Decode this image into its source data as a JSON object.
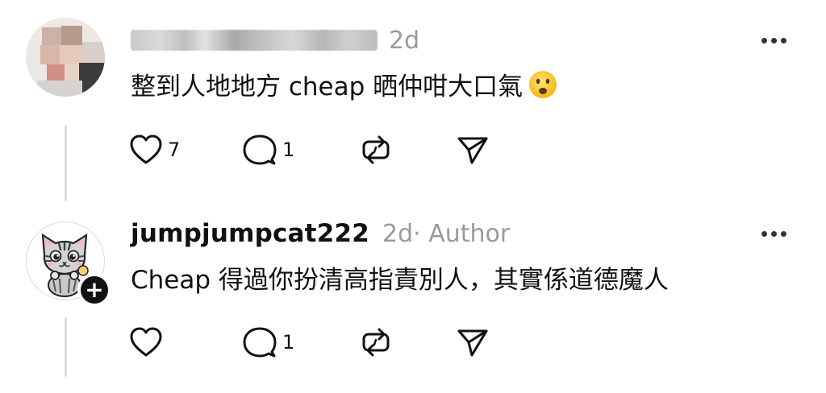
{
  "comments": [
    {
      "username": "",
      "username_redacted": true,
      "time": "2d",
      "author_tag": "",
      "text": "整到人地地方 cheap 晒仲咁大口氣",
      "emoji": "frowning-face-emoji",
      "likes": "7",
      "replies": "1",
      "show_follow_badge": false
    },
    {
      "username": "jumpjumpcat222",
      "username_redacted": false,
      "time": "2d",
      "author_tag": " · Author",
      "text": "Cheap 得過你扮清高指責別人，其實係道德魔人",
      "likes": "",
      "replies": "1",
      "show_follow_badge": true
    }
  ],
  "icons": {
    "like": "heart-icon",
    "reply": "comment-bubble-icon",
    "repost": "repost-icon",
    "share": "send-icon",
    "more": "more-horizontal-icon",
    "follow": "plus-icon"
  },
  "colors": {
    "text": "#111111",
    "muted": "#9a9a9a",
    "thread_line": "#dcdcdc",
    "follow_badge": "#111111"
  },
  "follow_badge_symbol": "+"
}
